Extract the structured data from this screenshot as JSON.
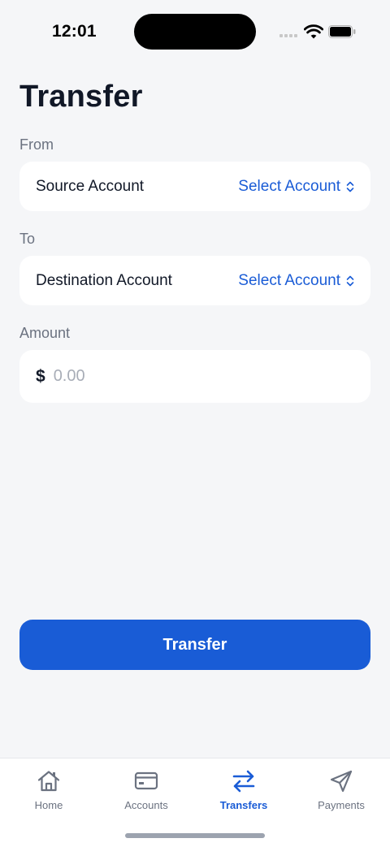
{
  "status_bar": {
    "time": "12:01"
  },
  "page": {
    "title": "Transfer"
  },
  "from": {
    "label": "From",
    "row_title": "Source Account",
    "select_label": "Select Account"
  },
  "to": {
    "label": "To",
    "row_title": "Destination Account",
    "select_label": "Select Account"
  },
  "amount": {
    "label": "Amount",
    "currency": "$",
    "value": "",
    "placeholder": "0.00"
  },
  "actions": {
    "transfer_label": "Transfer"
  },
  "tab_bar": {
    "tabs": [
      {
        "label": "Home",
        "icon": "house-icon",
        "active": false
      },
      {
        "label": "Accounts",
        "icon": "credit-card-icon",
        "active": false
      },
      {
        "label": "Transfers",
        "icon": "arrows-left-right-icon",
        "active": true
      },
      {
        "label": "Payments",
        "icon": "paper-plane-icon",
        "active": false
      }
    ]
  },
  "colors": {
    "accent": "#1A5CD6",
    "background": "#F5F6F8",
    "card": "#FFFFFF",
    "muted_text": "#6B7280"
  }
}
